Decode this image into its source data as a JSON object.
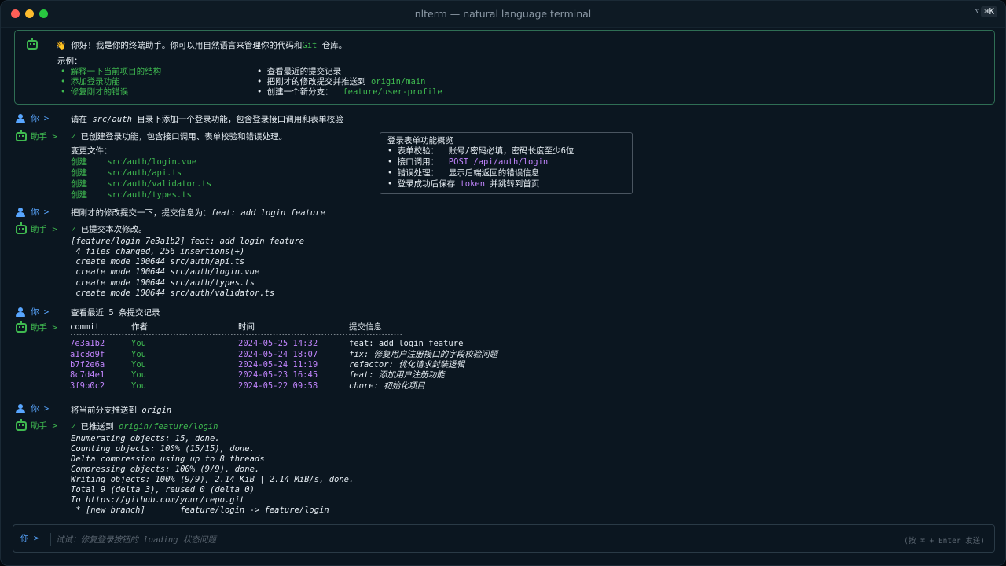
{
  "window": {
    "title": "nlterm — natural language terminal",
    "shortcut_prefix": "⌥",
    "shortcut_keys": "⌘K"
  },
  "welcome": {
    "greeting_wave": "👋",
    "greeting": "你好！我是你的终端助手。你可以用自然语言来管理你的代码和",
    "greeting_git": "Git",
    "greeting_tail": "仓库。",
    "examples_label": "示例：",
    "examples_left": [
      "• 解释一下当前项目的结构",
      "• 添加登录功能",
      "• 修复刚才的错误"
    ],
    "examples_right": [
      {
        "text": "• 查看最近的提交记录",
        "highlight": ""
      },
      {
        "text": "• 把刚才的修改提交并推送到 ",
        "highlight": "origin/main"
      },
      {
        "text": "• 创建一个新分支：  ",
        "highlight": "feature/user-profile"
      }
    ]
  },
  "labels": {
    "user": "你 >",
    "assistant": "助手 >"
  },
  "turn1": {
    "user_prefix": "请在 ",
    "user_path": "src/auth",
    "user_suffix": " 目录下添加一个登录功能，包含登录接口调用和表单校验",
    "reply_check": "✓",
    "reply": "已创建登录功能，包含接口调用、表单校验和错误处理。",
    "files_label": "变更文件：",
    "files": [
      {
        "action": "创建",
        "path": "src/auth/login.vue"
      },
      {
        "action": "创建",
        "path": "src/auth/api.ts"
      },
      {
        "action": "创建",
        "path": "src/auth/validator.ts"
      },
      {
        "action": "创建",
        "path": "src/auth/types.ts"
      }
    ],
    "info_title": "登录表单功能概览",
    "info_items": [
      {
        "pre": "• 表单校验：  账号/密码必填，密码长度至少6位",
        "hl": "",
        "post": ""
      },
      {
        "pre": "• 接口调用：  ",
        "hl": "POST /api/auth/login",
        "post": ""
      },
      {
        "pre": "• 错误处理：  显示后端返回的错误信息",
        "hl": "",
        "post": ""
      },
      {
        "pre": "• 登录成功后保存 ",
        "hl": "token",
        "post": " 并跳转到首页"
      }
    ]
  },
  "turn2": {
    "user_prefix": "把刚才的修改提交一下，提交信息为：",
    "user_msg": "feat: add login feature",
    "reply_check": "✓",
    "reply": "已提交本次修改。",
    "output": [
      "[feature/login 7e3a1b2] feat: add login feature",
      " 4 files changed, 256 insertions(+)",
      " create mode 100644 src/auth/api.ts",
      " create mode 100644 src/auth/login.vue",
      " create mode 100644 src/auth/types.ts",
      " create mode 100644 src/auth/validator.ts"
    ]
  },
  "turn3": {
    "user": "查看最近 5 条提交记录",
    "headers": [
      "commit",
      "作者",
      "时间",
      "提交信息"
    ],
    "divider": "--------------------------------------------------------------------------------------------------------------",
    "rows": [
      {
        "commit": "7e3a1b2",
        "author": "You",
        "time": "2024-05-25 14:32",
        "msg": "feat: add login feature"
      },
      {
        "commit": "a1c8d9f",
        "author": "You",
        "time": "2024-05-24 18:07",
        "msg": "fix: 修复用户注册接口的字段校验问题"
      },
      {
        "commit": "b7f2e6a",
        "author": "You",
        "time": "2024-05-24 11:19",
        "msg": "refactor: 优化请求封装逻辑"
      },
      {
        "commit": "8c7d4e1",
        "author": "You",
        "time": "2024-05-23 16:45",
        "msg": "feat: 添加用户注册功能"
      },
      {
        "commit": "3f9b0c2",
        "author": "You",
        "time": "2024-05-22 09:58",
        "msg": "chore: 初始化项目"
      }
    ]
  },
  "turn4": {
    "user_prefix": "将当前分支推送到 ",
    "user_target": "origin",
    "reply_check": "✓",
    "reply_prefix": "已推送到 ",
    "reply_target": "origin/feature/login",
    "output": [
      "Enumerating objects: 15, done.",
      "Counting objects: 100% (15/15), done.",
      "Delta compression using up to 8 threads",
      "Compressing objects: 100% (9/9), done.",
      "Writing objects: 100% (9/9), 2.14 KiB | 2.14 MiB/s, done.",
      "Total 9 (delta 3), reused 0 (delta 0)",
      "To https://github.com/your/repo.git",
      " * [new branch]       feature/login -> feature/login"
    ]
  },
  "input": {
    "label": "你 >",
    "placeholder": "试试：修复登录按钮的 loading 状态问题",
    "hint": "(按 ⌘ + Enter 发送)"
  }
}
